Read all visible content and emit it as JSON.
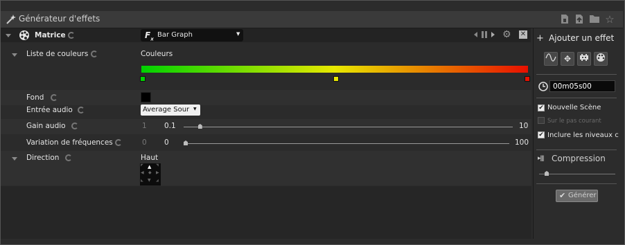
{
  "window": {
    "title": "Générateur d'effets"
  },
  "effect": {
    "name": "Matrice",
    "selected_effect": "Bar Graph"
  },
  "params": {
    "colors_label": "Liste de couleurs",
    "colors_value": "Couleurs",
    "gradient_stops": [
      "#00d200",
      "#e8e800",
      "#e81000"
    ],
    "fond_label": "Fond",
    "fond_color": "#000000",
    "audio_label": "Entrée audio",
    "audio_value": "Average Sour",
    "gain_label": "Gain audio",
    "gain_min": "1",
    "gain_value": "0.1",
    "gain_max": "10",
    "gain_level": 0.05,
    "var_label": "Variation de fréquences",
    "var_min": "0",
    "var_value": "0",
    "var_max": "100",
    "var_level": 0.0,
    "dir_label": "Direction",
    "dir_value": "Haut"
  },
  "side": {
    "add_label": "Ajouter un effet",
    "time_value": "00m05s00",
    "new_scene_label": "Nouvelle Scène",
    "new_scene_checked": true,
    "current_step_label": "Sur le pas courant",
    "current_step_checked": false,
    "include_levels_label": "Inclure les niveaux c",
    "include_levels_checked": true,
    "compression_label": "Compression",
    "compression_level": 0.1,
    "generate_label": "Générer"
  }
}
